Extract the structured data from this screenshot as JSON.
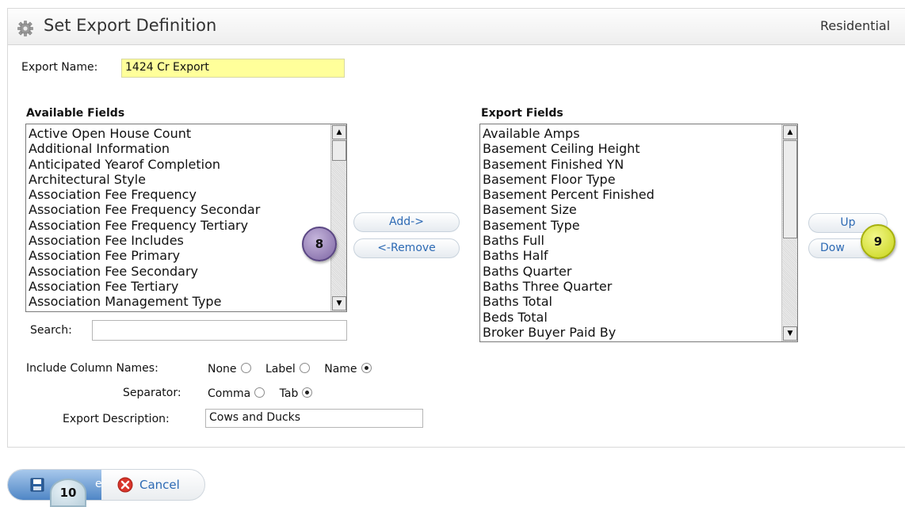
{
  "header": {
    "title": "Set Export Definition",
    "listing_type": "Residential"
  },
  "form": {
    "export_name_label": "Export Name:",
    "export_name_value": "1424 Cr Export",
    "available_fields_label": "Available Fields",
    "export_fields_label": "Export Fields",
    "search_label": "Search:",
    "search_value": "",
    "include_column_names_label": "Include Column Names:",
    "include_column_names_options": [
      "None",
      "Label",
      "Name"
    ],
    "include_column_names_selected": "Name",
    "separator_label": "Separator:",
    "separator_options": [
      "Comma",
      "Tab"
    ],
    "separator_selected": "Tab",
    "export_description_label": "Export Description:",
    "export_description_value": "Cows and Ducks"
  },
  "available_fields": [
    "Active Open House Count",
    "Additional Information",
    "Anticipated Yearof Completion",
    "Architectural Style",
    "Association Fee Frequency",
    "Association Fee Frequency Secondar",
    "Association Fee Frequency Tertiary",
    "Association Fee Includes",
    "Association Fee Primary",
    "Association Fee Secondary",
    "Association Fee Tertiary",
    "Association Management Type"
  ],
  "export_fields": [
    "Available Amps",
    "Basement Ceiling Height",
    "Basement Finished YN",
    "Basement Floor Type",
    "Basement Percent Finished",
    "Basement Size",
    "Basement Type",
    "Baths Full",
    "Baths Half",
    "Baths Quarter",
    "Baths Three Quarter",
    "Baths Total",
    "Beds Total",
    "Broker Buyer Paid By"
  ],
  "buttons": {
    "add": "Add->",
    "remove": "<-Remove",
    "up": "Up",
    "down": "Dow",
    "save": "e",
    "cancel": "Cancel"
  },
  "annotations": {
    "badge_8": "8",
    "badge_9": "9",
    "badge_10": "10"
  },
  "icons": {
    "title": "gear-icon",
    "save": "floppy-disk-icon",
    "cancel": "cancel-x-icon"
  },
  "colors": {
    "export_name_bg": "#ffff9a",
    "link_blue": "#2d6ab4",
    "cancel_red": "#d9352b",
    "badge_8": "#7d65a3",
    "badge_9": "#c8d418"
  }
}
